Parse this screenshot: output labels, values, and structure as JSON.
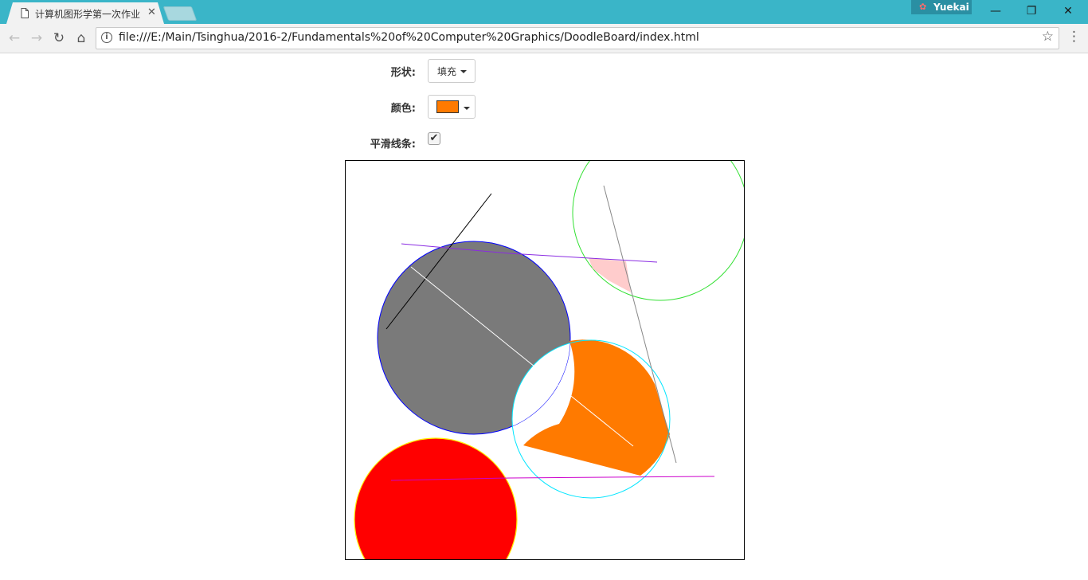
{
  "browser": {
    "tab_title": "计算机图形学第一次作业",
    "close_glyph": "✕",
    "profile_name": "Yuekai",
    "url": "file:///E:/Main/Tsinghua/2016-2/Fundamentals%20of%20Computer%20Graphics/DoodleBoard/index.html",
    "window_controls": {
      "minimize": "—",
      "restore": "❐",
      "close": "✕"
    }
  },
  "icons": {
    "back": "arrow-left-icon",
    "forward": "arrow-right-icon",
    "reload": "reload-icon",
    "home": "home-icon",
    "info": "info-icon",
    "bookmark": "star-icon",
    "menu": "kebab-menu-icon",
    "tab_page": "document-icon",
    "profile": "profile-icon"
  },
  "form": {
    "shape_label": "形状:",
    "shape_value": "填充",
    "color_label": "颜色:",
    "color_value": "#ff7a00",
    "smooth_label": "平滑线条:",
    "smooth_checked": true
  },
  "colors": {
    "titlebar": "#3ab5c8",
    "gray_fill": "#7a7a7a",
    "orange_fill": "#ff7a00",
    "red_fill": "#ff0000",
    "pink_fill": "#ffcccc",
    "blue_stroke": "#0000ff",
    "cyan_stroke": "#00e5ff",
    "green_stroke": "#33e033",
    "yellow_stroke": "#ffee00",
    "purple_stroke": "#8a2be2",
    "magenta_stroke": "#cc00cc"
  }
}
